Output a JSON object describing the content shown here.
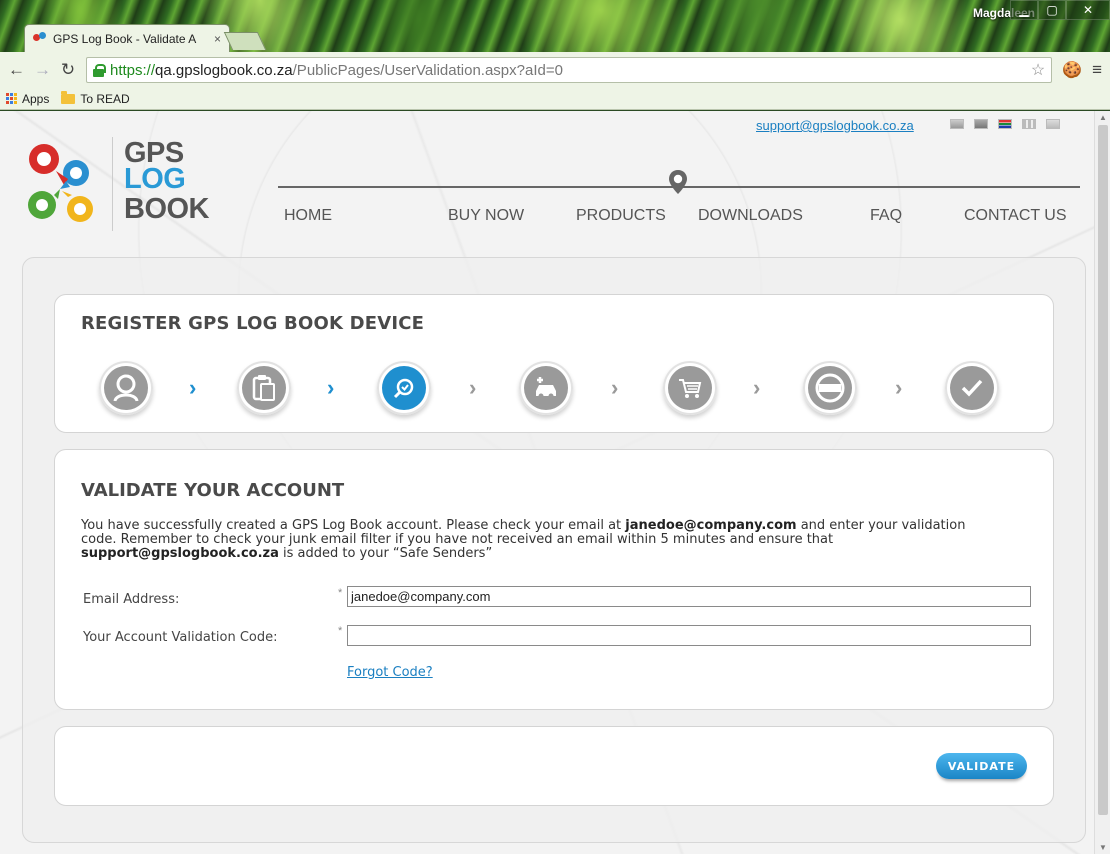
{
  "browser": {
    "tab_title": "GPS Log Book - Validate A",
    "tab_close": "×",
    "profile_name": "Magdaleen",
    "url_scheme": "https://",
    "url_host": "qa.gpslogbook.co.za",
    "url_path": "/PublicPages/UserValidation.aspx?aId=0",
    "bookmarks": [
      {
        "label": "Apps",
        "icon": "apps-grid-icon"
      },
      {
        "label": "To READ",
        "icon": "folder-icon"
      }
    ]
  },
  "header": {
    "support_email": "support@gpslogbook.co.za",
    "logo": {
      "line1": "GPS",
      "line2": "LOG",
      "line3": "BOOK"
    },
    "nav": [
      "HOME",
      "BUY NOW",
      "PRODUCTS",
      "DOWNLOADS",
      "FAQ",
      "CONTACT US"
    ]
  },
  "register": {
    "title": "REGISTER GPS LOG BOOK DEVICE",
    "steps": [
      {
        "icon": "user-icon",
        "state": "done"
      },
      {
        "icon": "clipboard-icon",
        "state": "done"
      },
      {
        "icon": "search-check-icon",
        "state": "active"
      },
      {
        "icon": "car-add-icon",
        "state": "todo"
      },
      {
        "icon": "cart-icon",
        "state": "todo"
      },
      {
        "icon": "credit-card-icon",
        "state": "todo"
      },
      {
        "icon": "checkmark-icon",
        "state": "todo"
      }
    ],
    "accent_color": "#1f8fcf"
  },
  "validate": {
    "title": "VALIDATE YOUR ACCOUNT",
    "message_part1": "You have successfully created a GPS Log Book account. Please check your email at ",
    "message_email": "janedoe@company.com",
    "message_part2": " and enter your validation code. Remember to check your junk email filter if you have not received an email within 5 minutes and ensure that ",
    "message_support": "support@gpslogbook.co.za",
    "message_part3": " is added to your “Safe Senders”",
    "email_label": "Email Address:",
    "email_value": "janedoe@company.com",
    "code_label": "Your Account Validation Code:",
    "code_value": "",
    "required_marker": "*",
    "forgot_link": "Forgot Code?",
    "button_label": "VALIDATE"
  }
}
